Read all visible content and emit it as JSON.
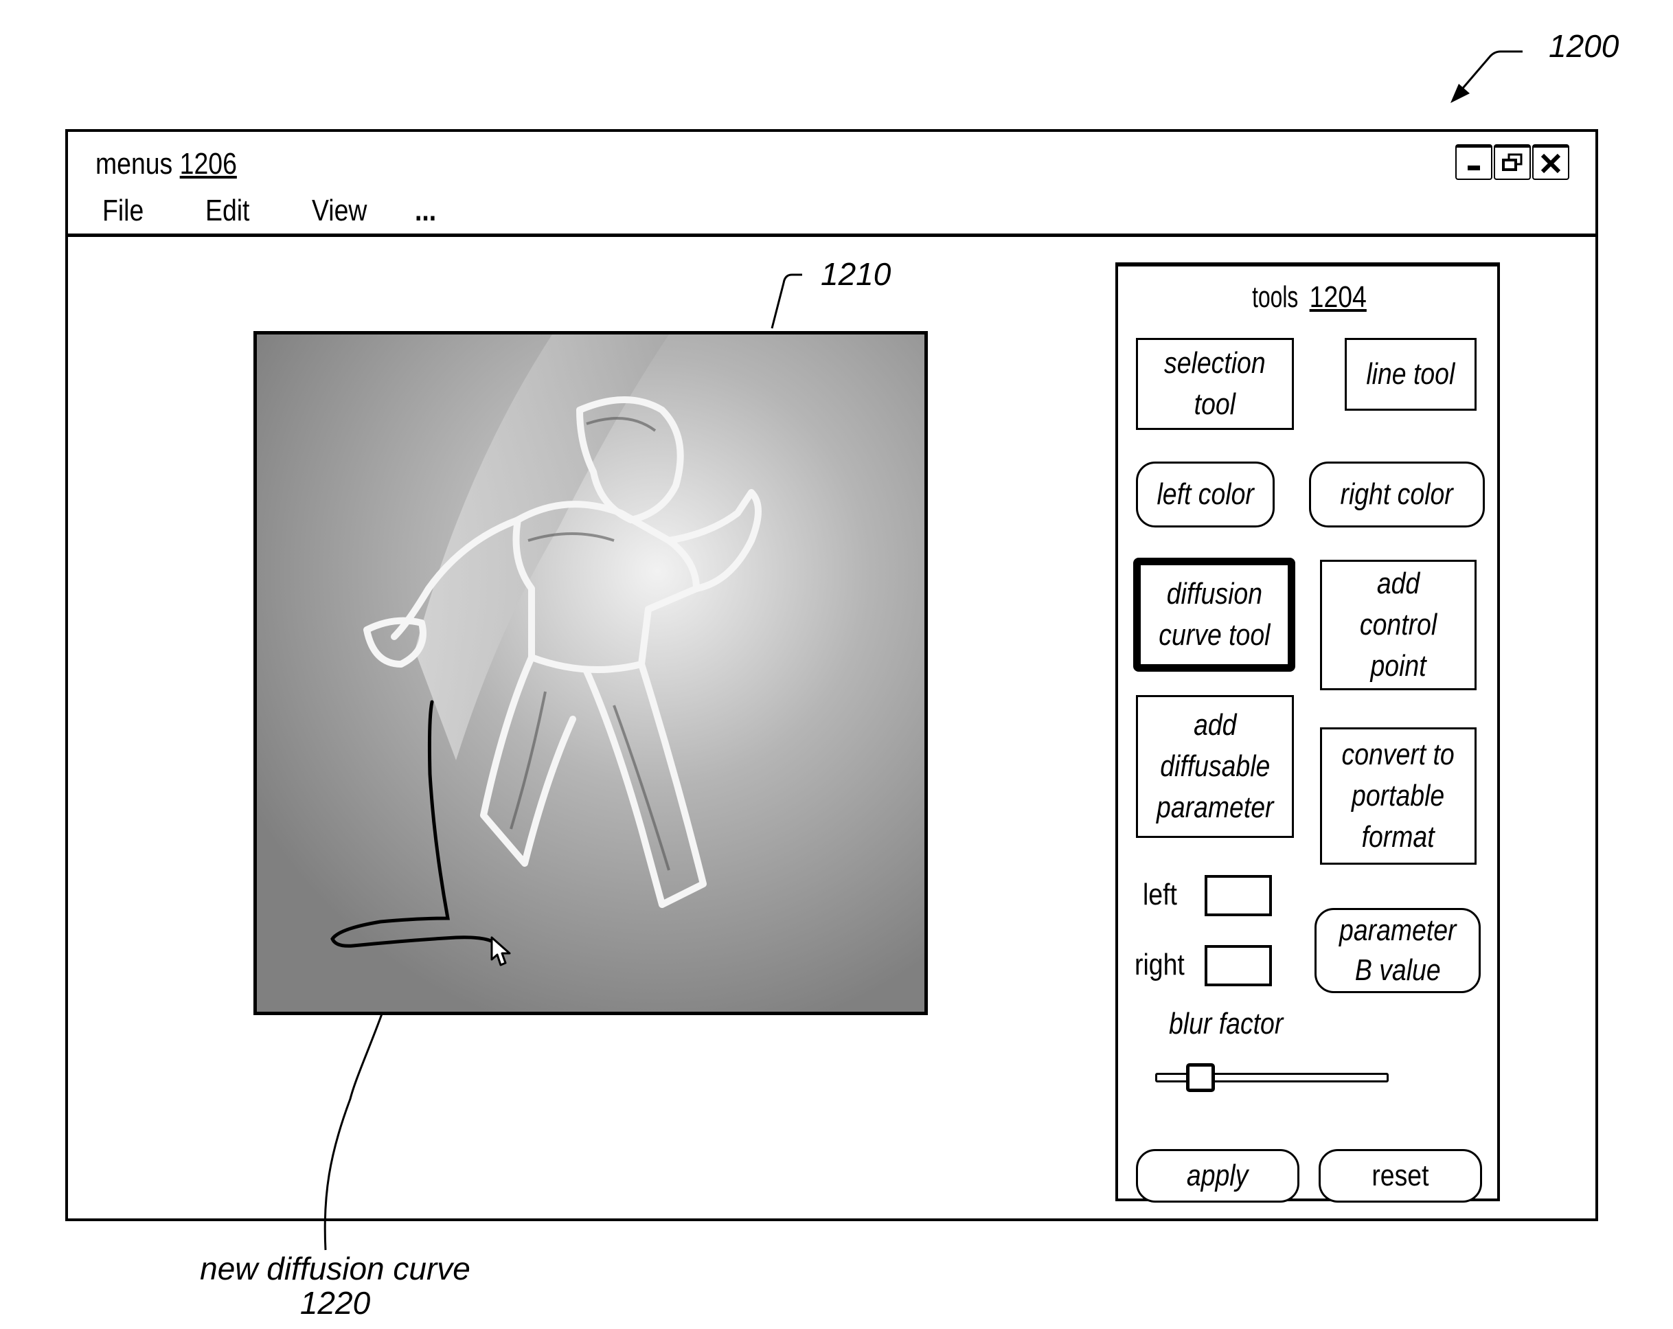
{
  "figure": {
    "ref_window": "1200",
    "ref_canvas": "1210",
    "callout": {
      "text": "new diffusion curve",
      "ref": "1220"
    }
  },
  "window": {
    "menus_label": "menus",
    "menus_ref": "1206",
    "menu_items": [
      "File",
      "Edit",
      "View",
      "..."
    ],
    "controls": [
      "minimize-icon",
      "restore-icon",
      "close-icon"
    ]
  },
  "tools": {
    "title": "tools",
    "ref": "1204",
    "buttons": {
      "selection_tool": "selection\ntool",
      "line_tool": "line tool",
      "left_color": "left color",
      "right_color": "right color",
      "diffusion_curve_tool": "diffusion\ncurve tool",
      "add_control_point": "add\ncontrol\npoint",
      "add_diffusable_parameter": "add\ndiffusable\nparameter",
      "convert_to_portable_format": "convert to\nportable\nformat",
      "parameter_b_value": "parameter\nB value",
      "apply": "apply",
      "reset": "reset"
    },
    "active_tool": "diffusion curve tool",
    "fields": {
      "left_label": "left",
      "left_value": "",
      "right_label": "right",
      "right_value": ""
    },
    "blur_factor": {
      "label": "blur factor",
      "value_fraction": 0.15
    }
  },
  "canvas": {
    "content": "grayscale diffusion-curve rendering of a dancing figure",
    "cursor": "arrow-cursor-icon"
  }
}
